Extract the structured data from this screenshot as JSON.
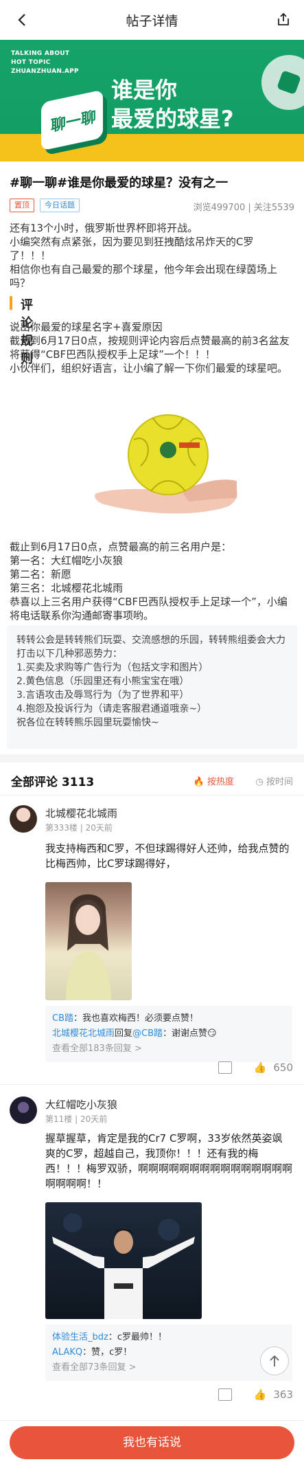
{
  "nav": {
    "title": "帖子详情",
    "back_icon": "back-arrow-icon",
    "share_icon": "share-icon"
  },
  "banner": {
    "tag_lines": [
      "TALKING ABOUT",
      "HOT TOPIC",
      "ZHUANZHUAN.APP"
    ],
    "cube_text": "聊一聊",
    "headline_lines": [
      "谁是你",
      "最爱的球星?"
    ],
    "colors": {
      "green": "#16a36a",
      "yellow": "#f4c21a"
    }
  },
  "post": {
    "title": "#聊一聊#谁是你最爱的球星？没有之一",
    "badge_top": "置顶",
    "badge_topic": "今日话题",
    "views": "浏览499700",
    "follows": "关注5539",
    "intro": [
      "还有13个小时，俄罗斯世界杯即将开战。",
      "小编突然有点紧张，因为要见到狂拽酷炫吊炸天的C罗了！！！",
      "相信你也有自己最爱的那个球星，他今年会出现在绿茵场上吗？"
    ],
    "rules_heading": "评论规则",
    "rules": [
      "说出你最爱的球星名字+喜爱原因",
      "截止到6月17日0点，按规则评论内容后点赞最高的前3名盆友将获得“CBF巴西队授权手上足球”一个！！！",
      "小伙伴们，组织好语言，让小编了解一下你们最爱的球星吧。"
    ],
    "winners": [
      "截止到6月17日0点，点赞最高的前三名用户是：",
      "第一名：大红帽吃小灰狼",
      "第二名：新愿",
      "第三名：北城樱花北城雨",
      "恭喜以上三名用户获得“CBF巴西队授权手上足球一个”，小编将电话联系你沟通邮寄事项哟。"
    ]
  },
  "notice": [
    "转转公会是转转熊们玩耍、交流感想的乐园，转转熊组委会大力打击以下几种邪恶势力：",
    "1.买卖及求购等广告行为（包括文字和图片）",
    "2.黄色信息（乐园里还有小熊宝宝在哦）",
    "3.言语攻击及辱骂行为（为了世界和平）",
    "4.抱怨及投诉行为（请走客服君通道哦亲~）",
    "祝各位在转转熊乐园里玩耍愉快~"
  ],
  "comments_header": {
    "title": "全部评论 3113",
    "sort_hot": "按热度",
    "sort_time": "按时间"
  },
  "comments": [
    {
      "name": "北城樱花北城雨",
      "floor": "第333楼",
      "time": "20天前",
      "body": "我支持梅西和C罗，不但球踢得好人还帅，给我点赞的比梅西帅，比C罗球踢得好，",
      "replies": [
        {
          "user": "CB踏",
          "text": "：我也喜欢梅西！必须要点赞！"
        },
        {
          "user": "北城樱花北城雨",
          "mid": "回复",
          "target": "@CB踏",
          "text": "：谢谢点赞😏"
        }
      ],
      "more": "查看全部183条回复 >",
      "likes": "650"
    },
    {
      "name": "大红帽吃小灰狼",
      "floor": "第11楼",
      "time": "20天前",
      "body": "握草握草，肯定是我的Cr7 C罗啊，33岁依然英姿飒爽的C罗，超越自己，我顶你！！！还有我的梅西！！！梅罗双骄，啊啊啊啊啊啊啊啊啊啊啊啊啊啊啊啊啊啊啊！！",
      "replies": [
        {
          "user": "体验生活_bdz",
          "text": "：c罗最帅！！"
        },
        {
          "user": "ALAKQ",
          "text": "：赞，c罗！"
        }
      ],
      "more": "查看全部73条回复 >",
      "likes": "363"
    }
  ],
  "bottom": {
    "cta": "我也有话说"
  }
}
